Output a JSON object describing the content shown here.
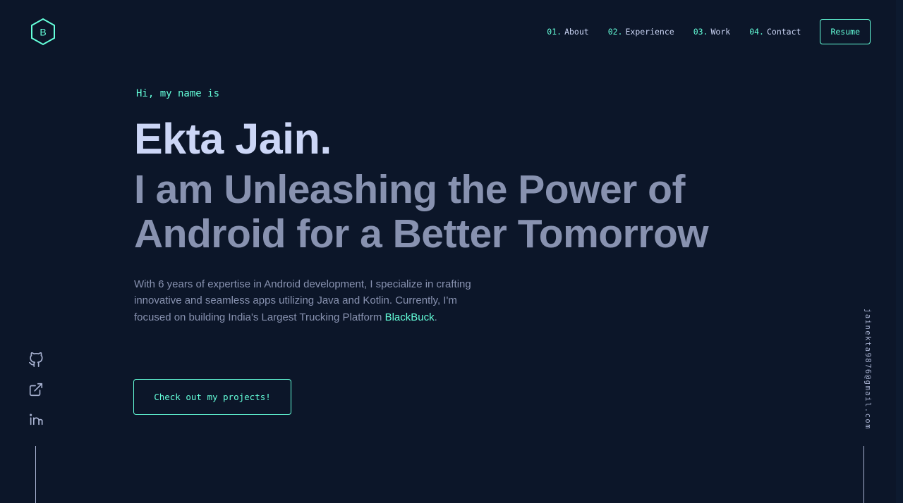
{
  "logo": {
    "letter": "B"
  },
  "nav": {
    "items": [
      {
        "num": "01.",
        "label": "About"
      },
      {
        "num": "02.",
        "label": "Experience"
      },
      {
        "num": "03.",
        "label": "Work"
      },
      {
        "num": "04.",
        "label": "Contact"
      }
    ],
    "resume_label": "Resume"
  },
  "hero": {
    "intro": "Hi, my name is",
    "name": "Ekta Jain.",
    "tagline": "I am Unleashing the Power of Android for a Better Tomorrow",
    "bio_text": "With 6 years of expertise in Android development, I specialize in crafting innovative and seamless apps utilizing Java and Kotlin. Currently, I'm focused on building India's Largest Trucking Platform ",
    "bio_link": "BlackBuck",
    "bio_end": ".",
    "cta_label": "Check out my projects!"
  },
  "social": {
    "icons": [
      "github-icon",
      "external-link-icon",
      "linkedin-icon"
    ]
  },
  "email": "jainekta9876@gmail.com",
  "colors": {
    "background": "#0c1629",
    "accent": "#64ffda",
    "heading": "#ccd6f6",
    "body": "#8892b0"
  }
}
